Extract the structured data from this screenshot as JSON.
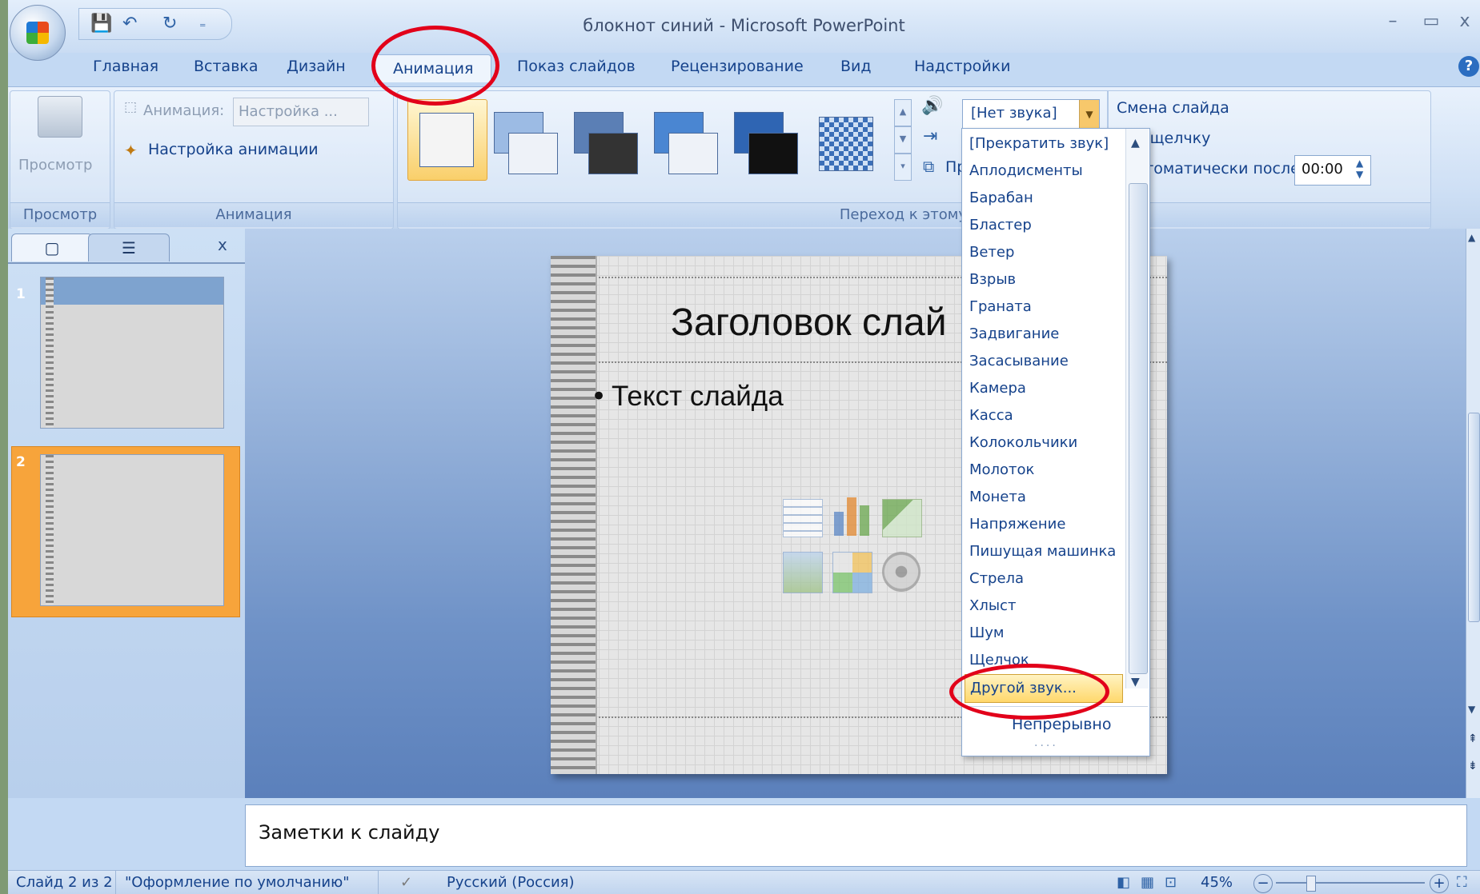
{
  "window": {
    "title": "блокнот синий - Microsoft PowerPoint",
    "minimize": "–",
    "restore": "▭",
    "close": "x"
  },
  "qat": {
    "save": "💾",
    "undo": "↶",
    "redo": "↻",
    "customize": "₌"
  },
  "tabs": [
    "Главная",
    "Вставка",
    "Дизайн",
    "Анимация",
    "Показ слайдов",
    "Рецензирование",
    "Вид",
    "Надстройки"
  ],
  "active_tab": "Анимация",
  "help": "?",
  "ribbon": {
    "preview": {
      "button_label": "Просмотр",
      "group_label": "Просмотр"
    },
    "animation": {
      "animation_label": "Анимация:",
      "animation_value": "Настройка ...",
      "custom_animation": "Настройка анимации",
      "group_label": "Анимация"
    },
    "transition": {
      "group_label": "Переход к этому сл",
      "sound_combo_value": "[Нет звука]",
      "apply_partial": "Пр",
      "advance_label": "Смена слайда",
      "on_click": "о щелчку",
      "auto_after": "втоматически после:",
      "auto_time": "00:00"
    }
  },
  "sound_list": {
    "items": [
      "[Прекратить звук]",
      "Аплодисменты",
      "Барабан",
      "Бластер",
      "Ветер",
      "Взрыв",
      "Граната",
      "Задвигание",
      "Засасывание",
      "Камера",
      "Касса",
      "Колокольчики",
      "Молоток",
      "Монета",
      "Напряжение",
      "Пишущая машинка",
      "Стрела",
      "Хлыст",
      "Шум",
      "Щелчок"
    ],
    "other_sound": "Другой звук...",
    "loop": "Непрерывно",
    "grip": "····"
  },
  "slide_panel": {
    "tab_close": "x",
    "slides": [
      "1",
      "2"
    ],
    "selected_slide": "2"
  },
  "slide": {
    "title": "Заголовок слай",
    "body": "Текст слайда",
    "bullet": "•"
  },
  "notes": {
    "placeholder": "Заметки к слайду"
  },
  "status": {
    "slide_info": "Слайд 2 из 2",
    "theme": "\"Оформление по умолчанию\"",
    "language": "Русский (Россия)",
    "zoom": "45%",
    "zoom_out": "−",
    "zoom_in": "+"
  },
  "colors": {
    "annotation": "#e2001a",
    "ribbon": "#cfe0f5",
    "selected_slide": "#f7a43b"
  }
}
